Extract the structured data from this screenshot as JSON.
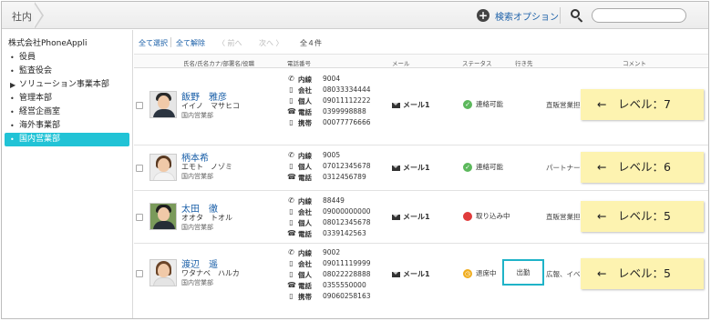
{
  "topbar": {
    "breadcrumb": "社内",
    "search_options_label": "検索オプション",
    "search_placeholder": ""
  },
  "sidebar": {
    "root": "株式会社PhoneAppli",
    "items": [
      {
        "mark": "•",
        "label": "役員"
      },
      {
        "mark": "•",
        "label": "監査役会"
      },
      {
        "mark": "▶",
        "label": "ソリューション事業本部"
      },
      {
        "mark": "•",
        "label": "管理本部"
      },
      {
        "mark": "•",
        "label": "経営企画室"
      },
      {
        "mark": "•",
        "label": "海外事業部"
      },
      {
        "mark": "•",
        "label": "国内営業部",
        "selected": true
      }
    ]
  },
  "toolbar": {
    "select_all": "全て選択",
    "deselect_all": "全て解除",
    "prev": "〈 前へ",
    "next": "次へ 〉",
    "count": "全４件"
  },
  "table": {
    "headers": {
      "name": "氏名/氏名カナ/部署名/役職",
      "phone": "電話番号",
      "mail": "メール",
      "status": "ステータス",
      "destination": "行き先",
      "comment": "コメント"
    },
    "rows": [
      {
        "name": "飯野　雅彦",
        "kana": "イイノ　マサヒコ",
        "dept": "国内営業部",
        "phones": [
          {
            "icon": "phone-icon",
            "type": "内線",
            "number": "9004"
          },
          {
            "icon": "mobile-icon",
            "type": "会社",
            "number": "08033334444"
          },
          {
            "icon": "mobile-icon",
            "type": "個人",
            "number": "09011112222"
          },
          {
            "icon": "fax-icon",
            "type": "電話",
            "number": "0399998888"
          },
          {
            "icon": "mobile-icon",
            "type": "携帯",
            "number": "00077776666"
          }
        ],
        "mail": "メール1",
        "status": "連絡可能",
        "status_color": "#5cb85c",
        "status_symbol": "✓",
        "destination": "",
        "comment": "直販営業担",
        "level": "←　レベル：7"
      },
      {
        "name": "柄本希",
        "kana": "エモト　ノゾミ",
        "dept": "国内営業部",
        "phones": [
          {
            "icon": "phone-icon",
            "type": "内線",
            "number": "9005"
          },
          {
            "icon": "mobile-icon",
            "type": "個人",
            "number": "07012345678"
          },
          {
            "icon": "fax-icon",
            "type": "電話",
            "number": "0312456789"
          }
        ],
        "mail": "メール1",
        "status": "連絡可能",
        "status_color": "#5cb85c",
        "status_symbol": "✓",
        "destination": "",
        "comment": "パートナー",
        "level": "←　レベル：6"
      },
      {
        "name": "太田　徹",
        "kana": "オオタ　トオル",
        "dept": "国内営業部",
        "phones": [
          {
            "icon": "phone-icon",
            "type": "内線",
            "number": "88449"
          },
          {
            "icon": "mobile-icon",
            "type": "会社",
            "number": "09000000000"
          },
          {
            "icon": "mobile-icon",
            "type": "個人",
            "number": "08012345678"
          },
          {
            "icon": "fax-icon",
            "type": "電話",
            "number": "0339142563"
          }
        ],
        "mail": "メール1",
        "status": "取り込み中",
        "status_color": "#e03b3b",
        "status_symbol": "",
        "destination": "",
        "comment": "直販営業担",
        "level": "←　レベル：5"
      },
      {
        "name": "渡辺　遥",
        "kana": "ワタナベ　ハルカ",
        "dept": "国内営業部",
        "phones": [
          {
            "icon": "phone-icon",
            "type": "内線",
            "number": "9002"
          },
          {
            "icon": "mobile-icon",
            "type": "会社",
            "number": "09011119999"
          },
          {
            "icon": "mobile-icon",
            "type": "個人",
            "number": "08022228888"
          },
          {
            "icon": "fax-icon",
            "type": "電話",
            "number": "0355550000"
          },
          {
            "icon": "mobile-icon",
            "type": "携帯",
            "number": "09060258163"
          }
        ],
        "mail": "メール1",
        "status": "退席中",
        "status_color": "#f0ad1e",
        "status_symbol": "◷",
        "destination": "出勤",
        "comment": "広報、イベ",
        "level": "←　レベル：5"
      }
    ]
  },
  "colors": {
    "accent": "#21c3d6",
    "link": "#1a5fa8",
    "note": "#fdf3b0"
  }
}
